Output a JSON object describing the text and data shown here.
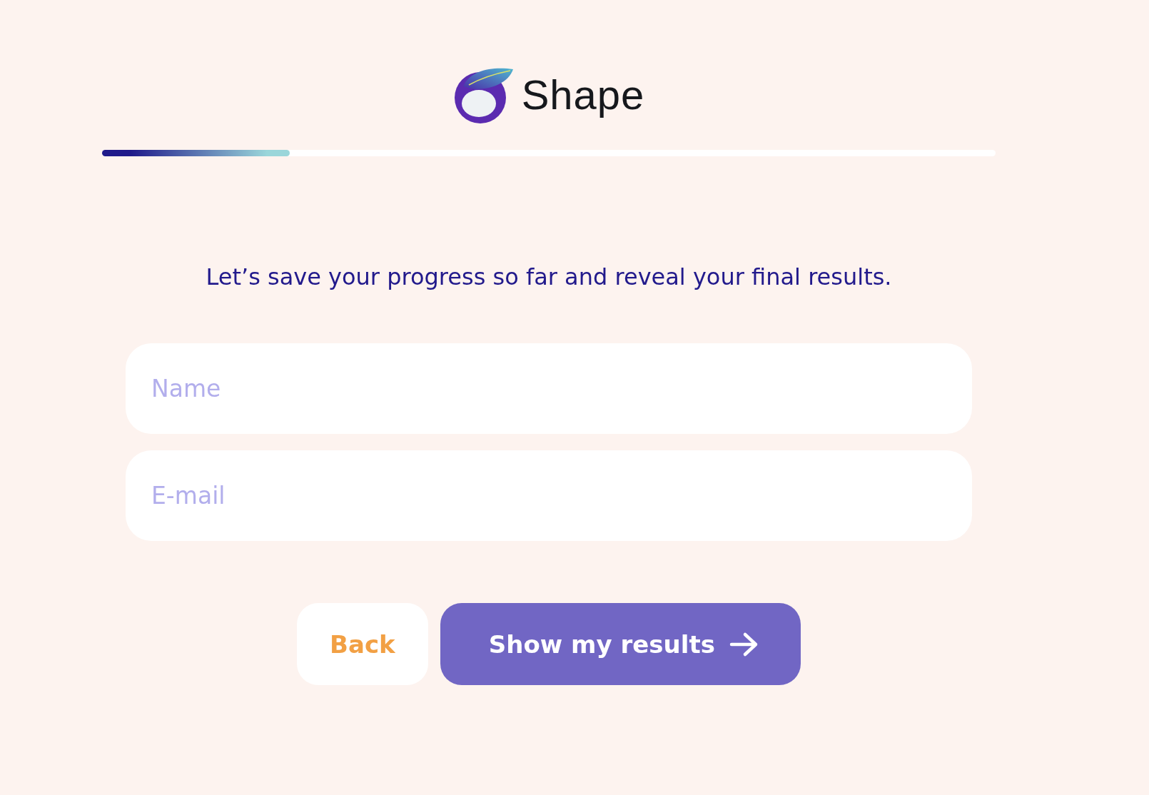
{
  "brand": {
    "name": "Shape"
  },
  "progress": {
    "level": 0.21
  },
  "message": "Let’s save your progress so far and reveal your final results.",
  "fields": [
    {
      "placeholder": "Name"
    },
    {
      "placeholder": "E-mail"
    }
  ],
  "buttons": [
    {
      "label": "Back",
      "kind": "secondary"
    },
    {
      "label": "Show my results",
      "kind": "primary"
    }
  ]
}
